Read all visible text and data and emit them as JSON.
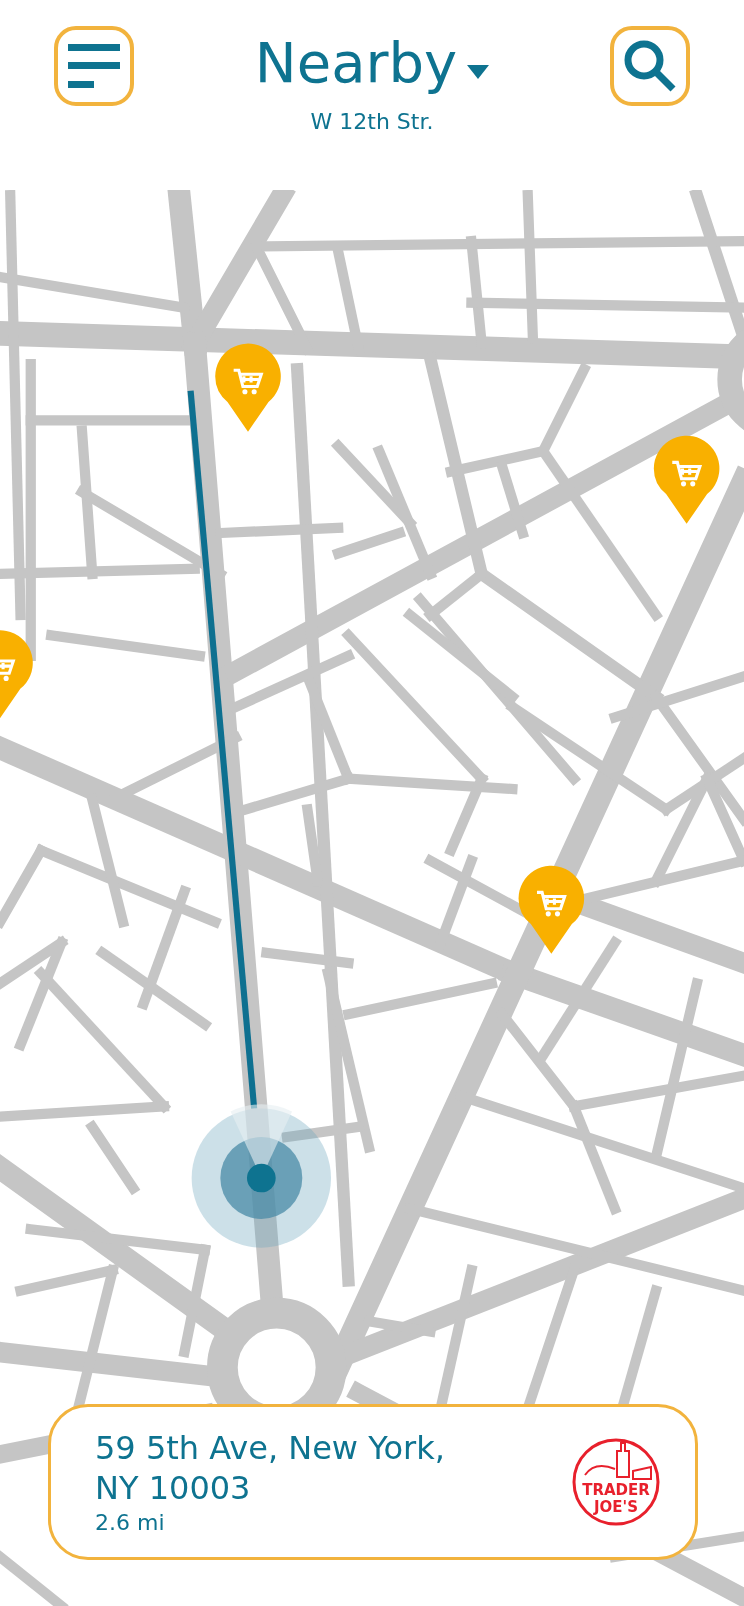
{
  "header": {
    "title": "Nearby",
    "subtitle": "W 12th Str."
  },
  "place_card": {
    "address": "59 5th Ave, New York,\nNY 10003",
    "distance": "2.6 mi",
    "logo_lines": [
      "TRADER",
      "JOE'S"
    ]
  }
}
